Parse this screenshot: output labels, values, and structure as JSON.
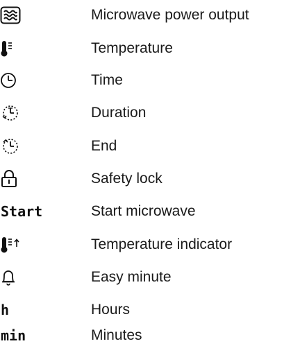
{
  "legend": {
    "rows": [
      {
        "icon": "microwave-power-icon",
        "label": "Microwave power output"
      },
      {
        "icon": "thermometer-icon",
        "label": "Temperature"
      },
      {
        "icon": "clock-icon",
        "label": "Time"
      },
      {
        "icon": "duration-icon",
        "label": "Duration"
      },
      {
        "icon": "end-time-icon",
        "label": "End"
      },
      {
        "icon": "padlock-icon",
        "label": "Safety lock"
      },
      {
        "icon": "start-symbol",
        "symbol": "Start",
        "label": "Start microwave"
      },
      {
        "icon": "thermometer-rising-icon",
        "label": "Temperature indicator"
      },
      {
        "icon": "bell-icon",
        "label": "Easy minute"
      },
      {
        "icon": "hours-symbol",
        "symbol": "h",
        "label": "Hours"
      },
      {
        "icon": "minutes-symbol",
        "symbol": "min",
        "label": "Minutes"
      }
    ]
  }
}
